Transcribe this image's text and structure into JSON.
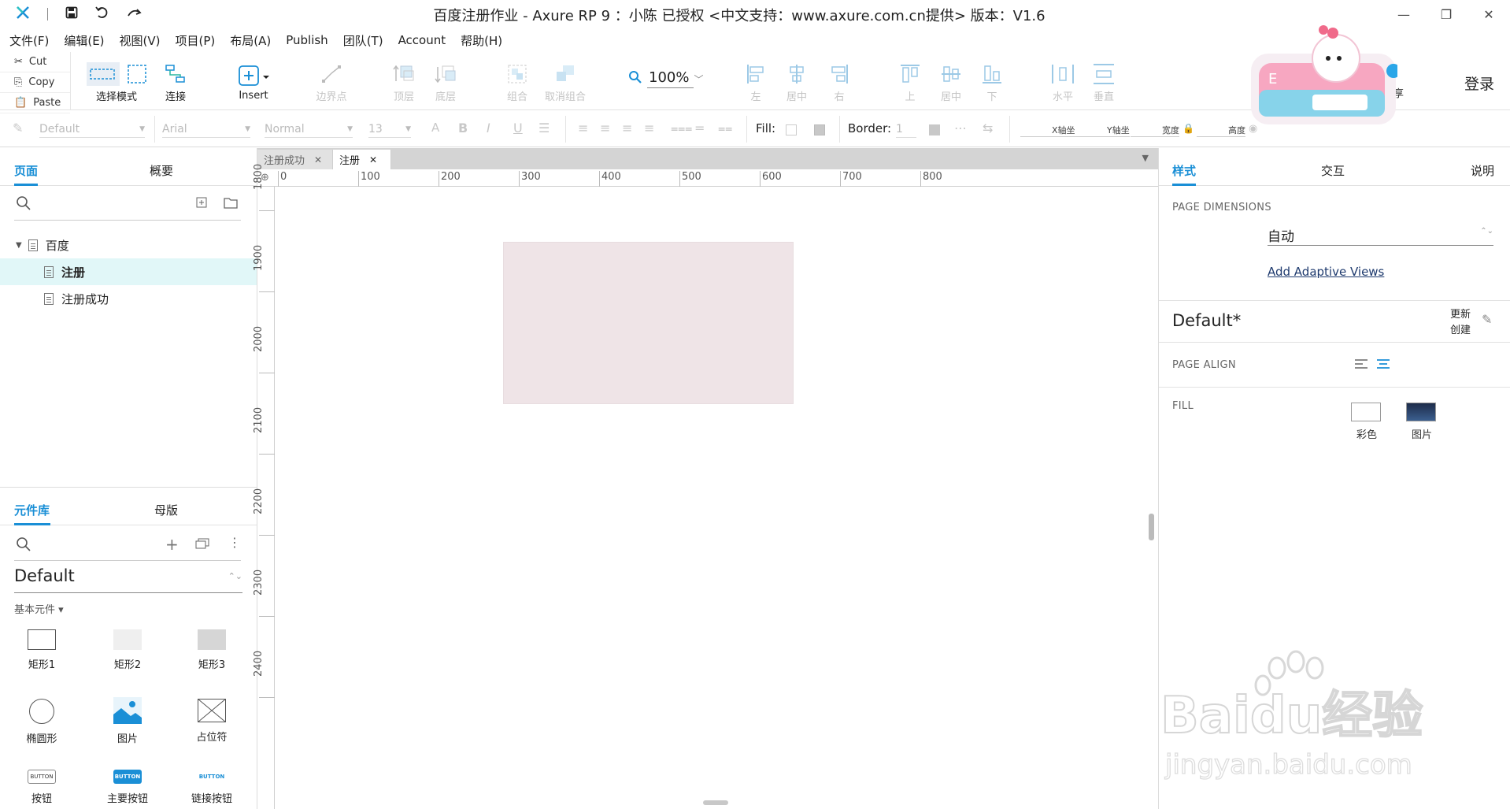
{
  "titlebar": {
    "title": "百度注册作业 - Axure RP 9 ：小陈 已授权    <中文支持：www.axure.com.cn提供> 版本：V1.6"
  },
  "menu": [
    "文件(F)",
    "编辑(E)",
    "视图(V)",
    "项目(P)",
    "布局(A)",
    "Publish",
    "团队(T)",
    "Account",
    "帮助(H)"
  ],
  "clipboard": {
    "cut": "Cut",
    "copy": "Copy",
    "paste": "Paste"
  },
  "toolbar": {
    "select_mode": "选择模式",
    "connect": "连接",
    "insert": "Insert",
    "boundary": "边界点",
    "top_layer": "顶层",
    "bottom_layer": "底层",
    "group": "组合",
    "ungroup": "取消组合",
    "zoom": "100%",
    "align_left": "左",
    "align_center": "居中",
    "align_right": "右",
    "align_top": "上",
    "align_middle": "居中",
    "align_bottom": "下",
    "dist_horizontal": "水平",
    "dist_vertical": "垂直",
    "share_partial": "享",
    "login": "登录"
  },
  "formatbar": {
    "style": "Default",
    "font": "Arial",
    "weight": "Normal",
    "size": "13",
    "fill_label": "Fill:",
    "border_label": "Border:",
    "border_value": "1",
    "x_label": "X轴坐",
    "y_label": "Y轴坐",
    "w_label": "宽度",
    "h_label": "高度"
  },
  "leftpanel": {
    "tab_pages": "页面",
    "tab_outline": "概要",
    "tree": [
      {
        "label": "百度",
        "level": 0,
        "selected": false
      },
      {
        "label": "注册",
        "level": 1,
        "selected": true
      },
      {
        "label": "注册成功",
        "level": 1,
        "selected": false
      }
    ],
    "tab_library": "元件库",
    "tab_masters": "母版",
    "library_name": "Default",
    "library_section": "基本元件 ▾",
    "widgets": [
      "矩形1",
      "矩形2",
      "矩形3",
      "椭圆形",
      "图片",
      "占位符",
      "按钮",
      "主要按钮",
      "链接按钮"
    ],
    "button_text": "BUTTON"
  },
  "canvas": {
    "tabs": [
      "注册成功",
      "注册"
    ],
    "active_tab": 1,
    "hruler": [
      "0",
      "100",
      "200",
      "300",
      "400",
      "500",
      "600",
      "700",
      "800"
    ],
    "vruler": [
      "1800",
      "1900",
      "2000",
      "2100",
      "2200",
      "2300",
      "2400"
    ]
  },
  "rightpanel": {
    "tab_style": "样式",
    "tab_interact": "交互",
    "tab_notes": "说明",
    "page_dimensions_label": "PAGE DIMENSIONS",
    "page_dimensions_value": "自动",
    "adaptive_link": "Add Adaptive Views",
    "style_name": "Default*",
    "update": "更新",
    "create": "创建",
    "page_align_label": "PAGE ALIGN",
    "fill_label": "FILL",
    "fill_color": "彩色",
    "fill_image": "图片"
  },
  "watermark": {
    "brand": "Baidu经验",
    "url": "jingyan.baidu.com"
  },
  "colors": {
    "accent": "#1a8fd6",
    "selected_row": "#e1f7f8",
    "canvas_rect": "#efe4e7"
  }
}
